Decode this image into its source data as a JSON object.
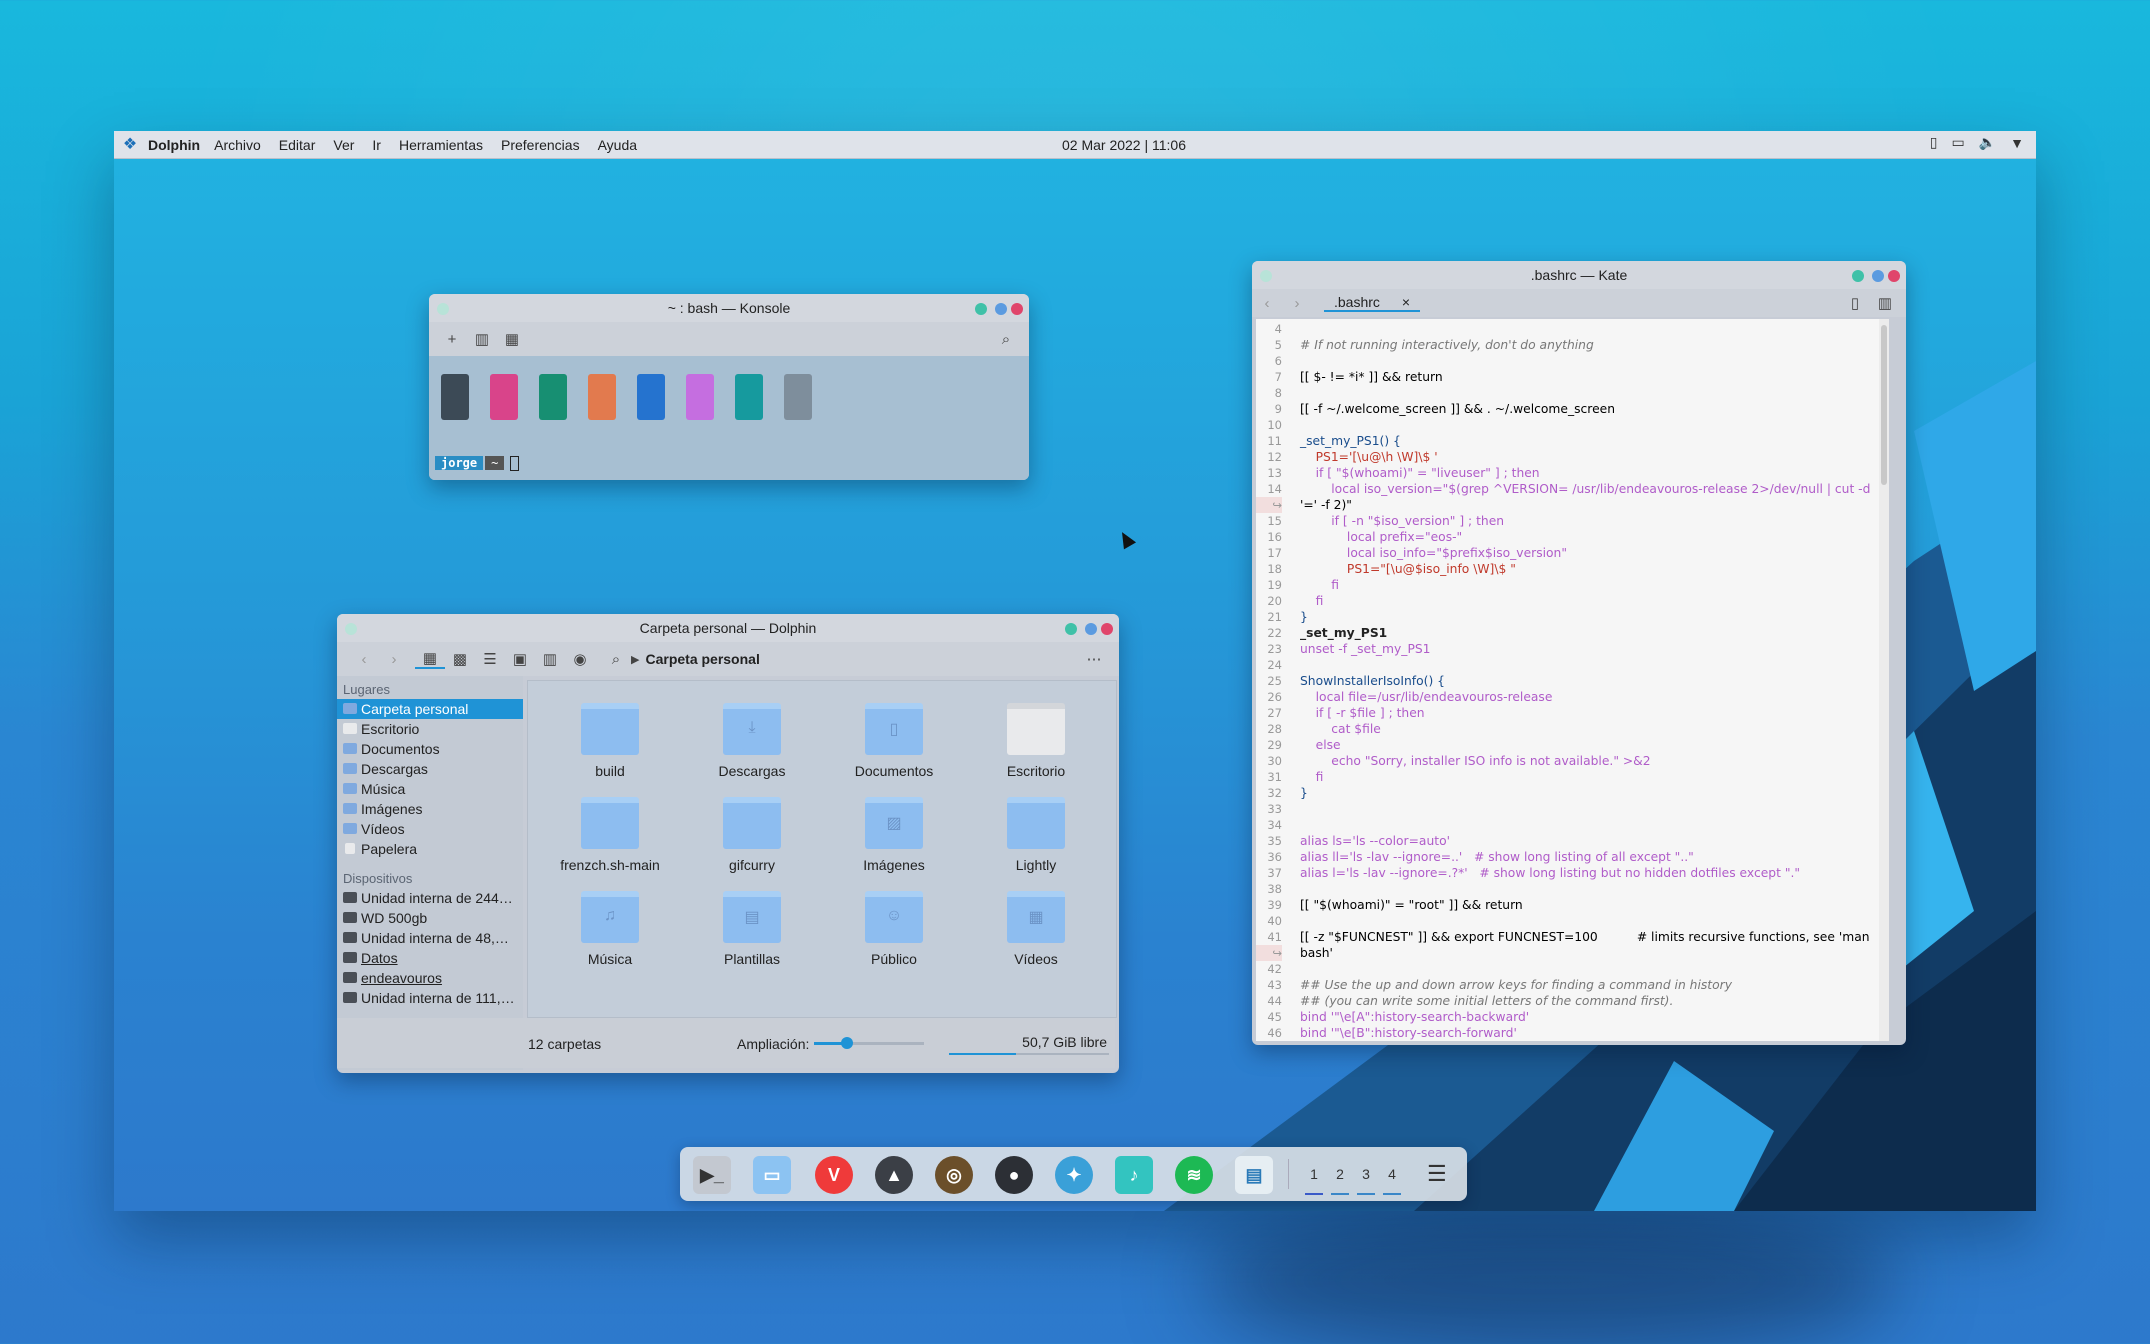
{
  "topbar": {
    "app": "Dolphin",
    "menus": [
      "Archivo",
      "Editar",
      "Ver",
      "Ir",
      "Herramientas",
      "Preferencias",
      "Ayuda"
    ],
    "clock": "02 Mar 2022 | 11:06"
  },
  "konsole": {
    "title": "~ : bash — Konsole",
    "prompt_user": "jorge",
    "prompt_dir": "~"
  },
  "dolphin": {
    "title": "Carpeta personal — Dolphin",
    "breadcrumb": "Carpeta personal",
    "places_heading": "Lugares",
    "places": [
      "Carpeta personal",
      "Escritorio",
      "Documentos",
      "Descargas",
      "Música",
      "Imágenes",
      "Vídeos",
      "Papelera"
    ],
    "devices_heading": "Dispositivos",
    "devices": [
      "Unidad interna de 244…",
      "WD 500gb",
      "Unidad interna de 48,…",
      "Datos",
      "endeavouros",
      "Unidad interna de 111,…"
    ],
    "folders": [
      "build",
      "Descargas",
      "Documentos",
      "Escritorio",
      "frenzch.sh-main",
      "gifcurry",
      "Imágenes",
      "Lightly",
      "Música",
      "Plantillas",
      "Público",
      "Vídeos"
    ],
    "status_count": "12 carpetas",
    "zoom_label": "Ampliación:",
    "zoom_level": 0.3,
    "free_space": "50,7 GiB libre"
  },
  "kate": {
    "title": ".bashrc — Kate",
    "tab": ".bashrc",
    "line_numbers": [
      "4",
      "5",
      "6",
      "7",
      "8",
      "9",
      "10",
      "11",
      "12",
      "13",
      "14",
      "↪",
      "15",
      "16",
      "17",
      "18",
      "19",
      "20",
      "21",
      "22",
      "23",
      "24",
      "25",
      "26",
      "27",
      "28",
      "29",
      "30",
      "31",
      "32",
      "33",
      "34",
      "35",
      "36",
      "37",
      "38",
      "39",
      "40",
      "41",
      "↪",
      "42",
      "43",
      "44",
      "45",
      "46"
    ],
    "lines": [
      "",
      "# If not running interactively, don't do anything",
      "",
      "[[ $- != *i* ]] && return",
      "",
      "[[ -f ~/.welcome_screen ]] && . ~/.welcome_screen",
      "",
      "_set_my_PS1() {",
      "    PS1='[\\u@\\h \\W]\\$ '",
      "    if [ \"$(whoami)\" = \"liveuser\" ] ; then",
      "        local iso_version=\"$(grep ^VERSION= /usr/lib/endeavouros-release 2>/dev/null | cut -d",
      "'=' -f 2)\"",
      "        if [ -n \"$iso_version\" ] ; then",
      "            local prefix=\"eos-\"",
      "            local iso_info=\"$prefix$iso_version\"",
      "            PS1=\"[\\u@$iso_info \\W]\\$ \"",
      "        fi",
      "    fi",
      "}",
      "_set_my_PS1",
      "unset -f _set_my_PS1",
      "",
      "ShowInstallerIsoInfo() {",
      "    local file=/usr/lib/endeavouros-release",
      "    if [ -r $file ] ; then",
      "        cat $file",
      "    else",
      "        echo \"Sorry, installer ISO info is not available.\" >&2",
      "    fi",
      "}",
      "",
      "",
      "alias ls='ls --color=auto'",
      "alias ll='ls -lav --ignore=..'   # show long listing of all except \"..\"",
      "alias l='ls -lav --ignore=.?*'   # show long listing but no hidden dotfiles except \".\"",
      "",
      "[[ \"$(whoami)\" = \"root\" ]] && return",
      "",
      "[[ -z \"$FUNCNEST\" ]] && export FUNCNEST=100          # limits recursive functions, see 'man",
      "bash'",
      "",
      "## Use the up and down arrow keys for finding a command in history",
      "## (you can write some initial letters of the command first).",
      "bind '\"\\e[A\":history-search-backward'",
      "bind '\"\\e[B\":history-search-forward'"
    ]
  },
  "dock": {
    "workspaces": [
      "1",
      "2",
      "3",
      "4"
    ]
  },
  "colors": {
    "accent": "#1f93d6",
    "close": "#e0456b",
    "maximize": "#5b9be0",
    "minimize": "#3fc1a8"
  },
  "icons": [
    "terminal-icon",
    "folder-icon",
    "vivaldi-icon",
    "inkscape-icon",
    "gimp-icon",
    "obs-icon",
    "kdeconnect-icon",
    "discover-icon",
    "spotify-icon",
    "book-icon",
    "menu-icon"
  ]
}
